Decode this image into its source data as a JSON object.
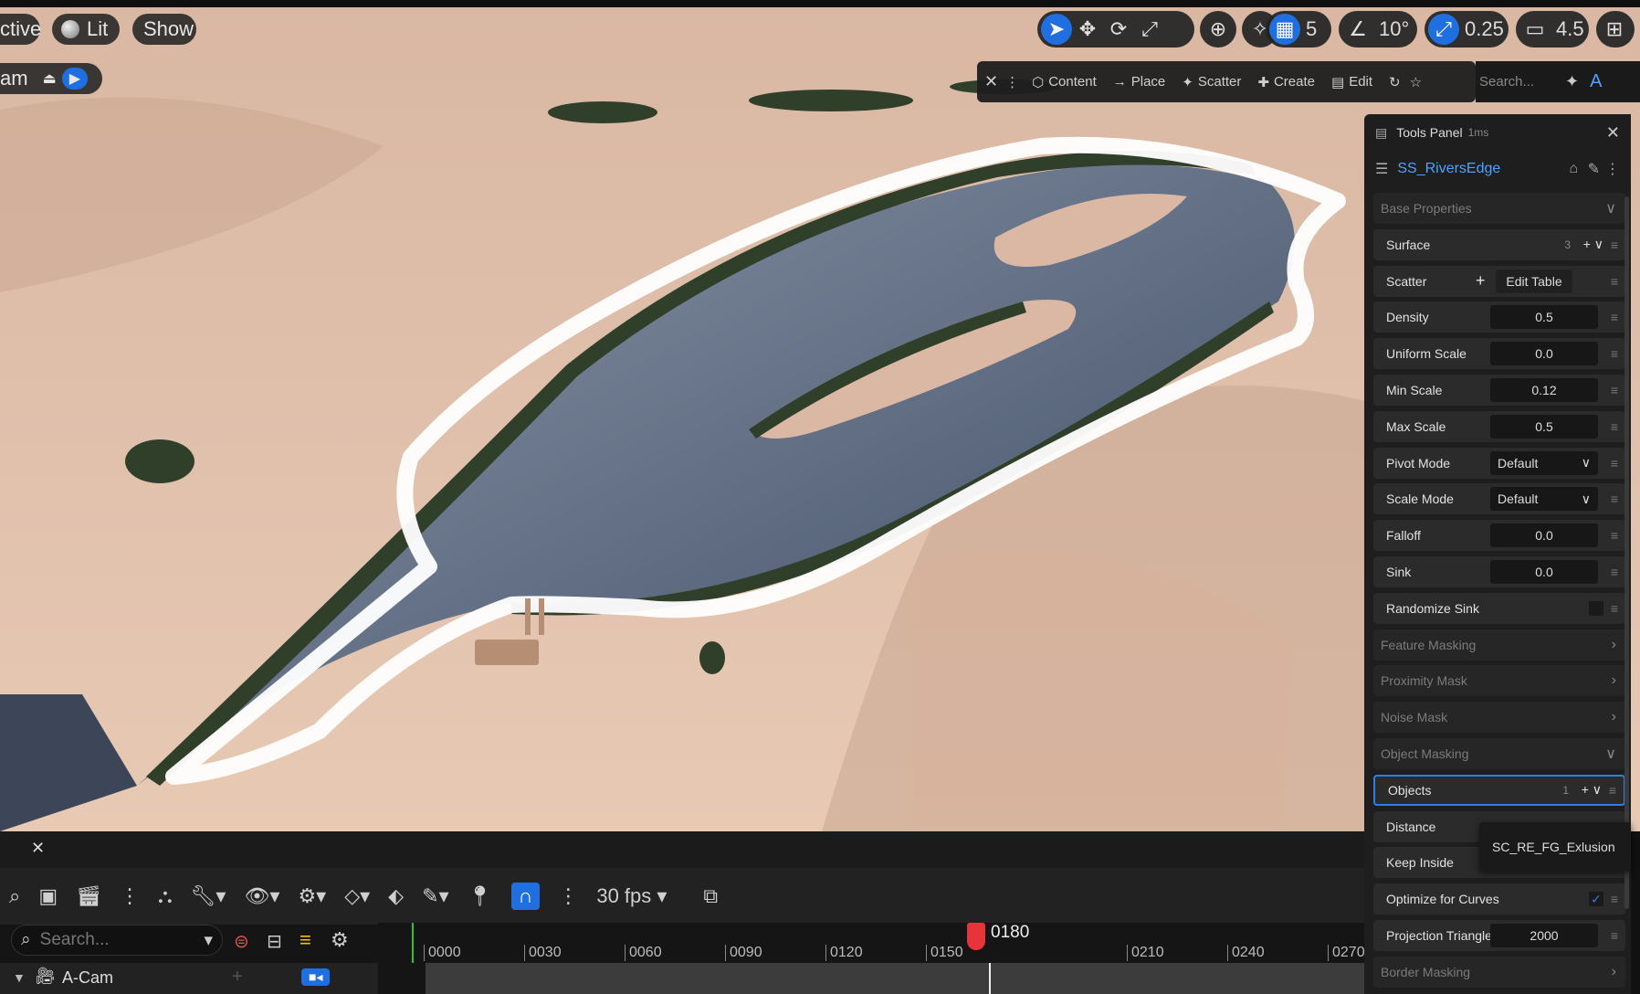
{
  "viewport": {
    "mode_label": "ctive",
    "lit_label": "Lit",
    "show_label": "Show",
    "cam_label": "am",
    "grid_value": "5",
    "angle_value": "10°",
    "scale_value": "0.25",
    "camera_speed": "4.5"
  },
  "context_bar": {
    "items": [
      "Content",
      "Place",
      "Scatter",
      "Create",
      "Edit"
    ],
    "search_placeholder": "Search..."
  },
  "tools_panel": {
    "title": "Tools Panel",
    "timing": "1ms",
    "asset_name": "SS_RiversEdge",
    "rows": [
      {
        "label": "Base Properties",
        "kind": "section"
      },
      {
        "label": "Surface",
        "kind": "count",
        "value": "3"
      },
      {
        "label": "Scatter",
        "kind": "button",
        "value": "Edit Table"
      },
      {
        "label": "Density",
        "kind": "number",
        "value": "0.5"
      },
      {
        "label": "Uniform Scale",
        "kind": "number",
        "value": "0.0"
      },
      {
        "label": "Min Scale",
        "kind": "number",
        "value": "0.12"
      },
      {
        "label": "Max Scale",
        "kind": "number",
        "value": "0.5"
      },
      {
        "label": "Pivot Mode",
        "kind": "dropdown",
        "value": "Default"
      },
      {
        "label": "Scale Mode",
        "kind": "dropdown",
        "value": "Default"
      },
      {
        "label": "Falloff",
        "kind": "number",
        "value": "0.0"
      },
      {
        "label": "Sink",
        "kind": "number",
        "value": "0.0"
      },
      {
        "label": "Randomize Sink",
        "kind": "checkbox"
      },
      {
        "label": "Feature Masking",
        "kind": "section-collapsed"
      },
      {
        "label": "Proximity Mask",
        "kind": "section-collapsed"
      },
      {
        "label": "Noise Mask",
        "kind": "section-collapsed"
      },
      {
        "label": "Object Masking",
        "kind": "section"
      },
      {
        "label": "Objects",
        "kind": "count",
        "value": "1",
        "selected": true
      },
      {
        "label": "Distance",
        "kind": "plain"
      },
      {
        "label": "Keep Inside",
        "kind": "plain"
      },
      {
        "label": "Optimize for Curves",
        "kind": "check"
      },
      {
        "label": "Projection Triangles",
        "kind": "number",
        "value": "2000"
      },
      {
        "label": "Border Masking",
        "kind": "section-collapsed"
      }
    ],
    "popup_item": "SC_RE_FG_Exlusion"
  },
  "sequencer": {
    "fps_label": "30 fps",
    "search_placeholder": "Search...",
    "current_frame": "0180",
    "ticks": [
      "0000",
      "0030",
      "0060",
      "0090",
      "0120",
      "0150",
      "0210",
      "0240",
      "0270"
    ],
    "track_name": "A-Cam"
  },
  "colors": {
    "accent": "#1f6fe0",
    "playhead": "#e8333a",
    "panel_bg": "#1e1e1e",
    "link": "#4aa3ff"
  }
}
